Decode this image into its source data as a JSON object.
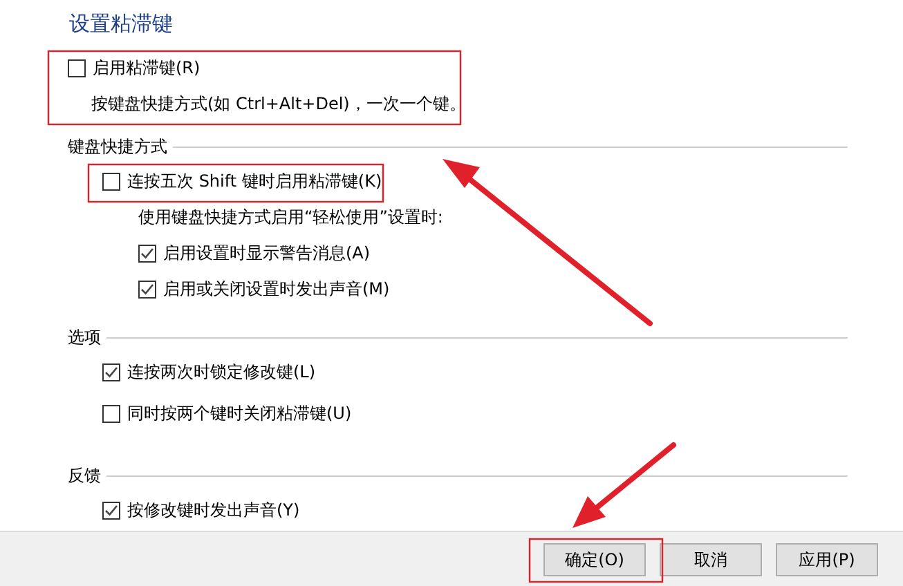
{
  "title": "设置粘滞键",
  "main_option": {
    "label": "启用粘滞键(R)",
    "checked": false
  },
  "description": "按键盘快捷方式(如 Ctrl+Alt+Del)，一次一个键。",
  "groups": [
    {
      "heading": "键盘快捷方式",
      "items": [
        {
          "kind": "checkbox",
          "label": "连按五次 Shift 键时启用粘滞键(K)",
          "checked": false
        },
        {
          "kind": "note",
          "text": "使用键盘快捷方式启用“轻松使用”设置时:",
          "children": [
            {
              "kind": "checkbox",
              "label": "启用设置时显示警告消息(A)",
              "checked": true
            },
            {
              "kind": "checkbox",
              "label": "启用或关闭设置时发出声音(M)",
              "checked": true
            }
          ]
        }
      ]
    },
    {
      "heading": "选项",
      "items": [
        {
          "kind": "checkbox",
          "label": "连按两次时锁定修改键(L)",
          "checked": true
        },
        {
          "kind": "checkbox",
          "label": "同时按两个键时关闭粘滞键(U)",
          "checked": false
        }
      ]
    },
    {
      "heading": "反馈",
      "items": [
        {
          "kind": "checkbox",
          "label": "按修改键时发出声音(Y)",
          "checked": true
        }
      ]
    }
  ],
  "buttons": [
    {
      "label": "确定(O)"
    },
    {
      "label": "取消"
    },
    {
      "label": "应用(P)"
    }
  ]
}
